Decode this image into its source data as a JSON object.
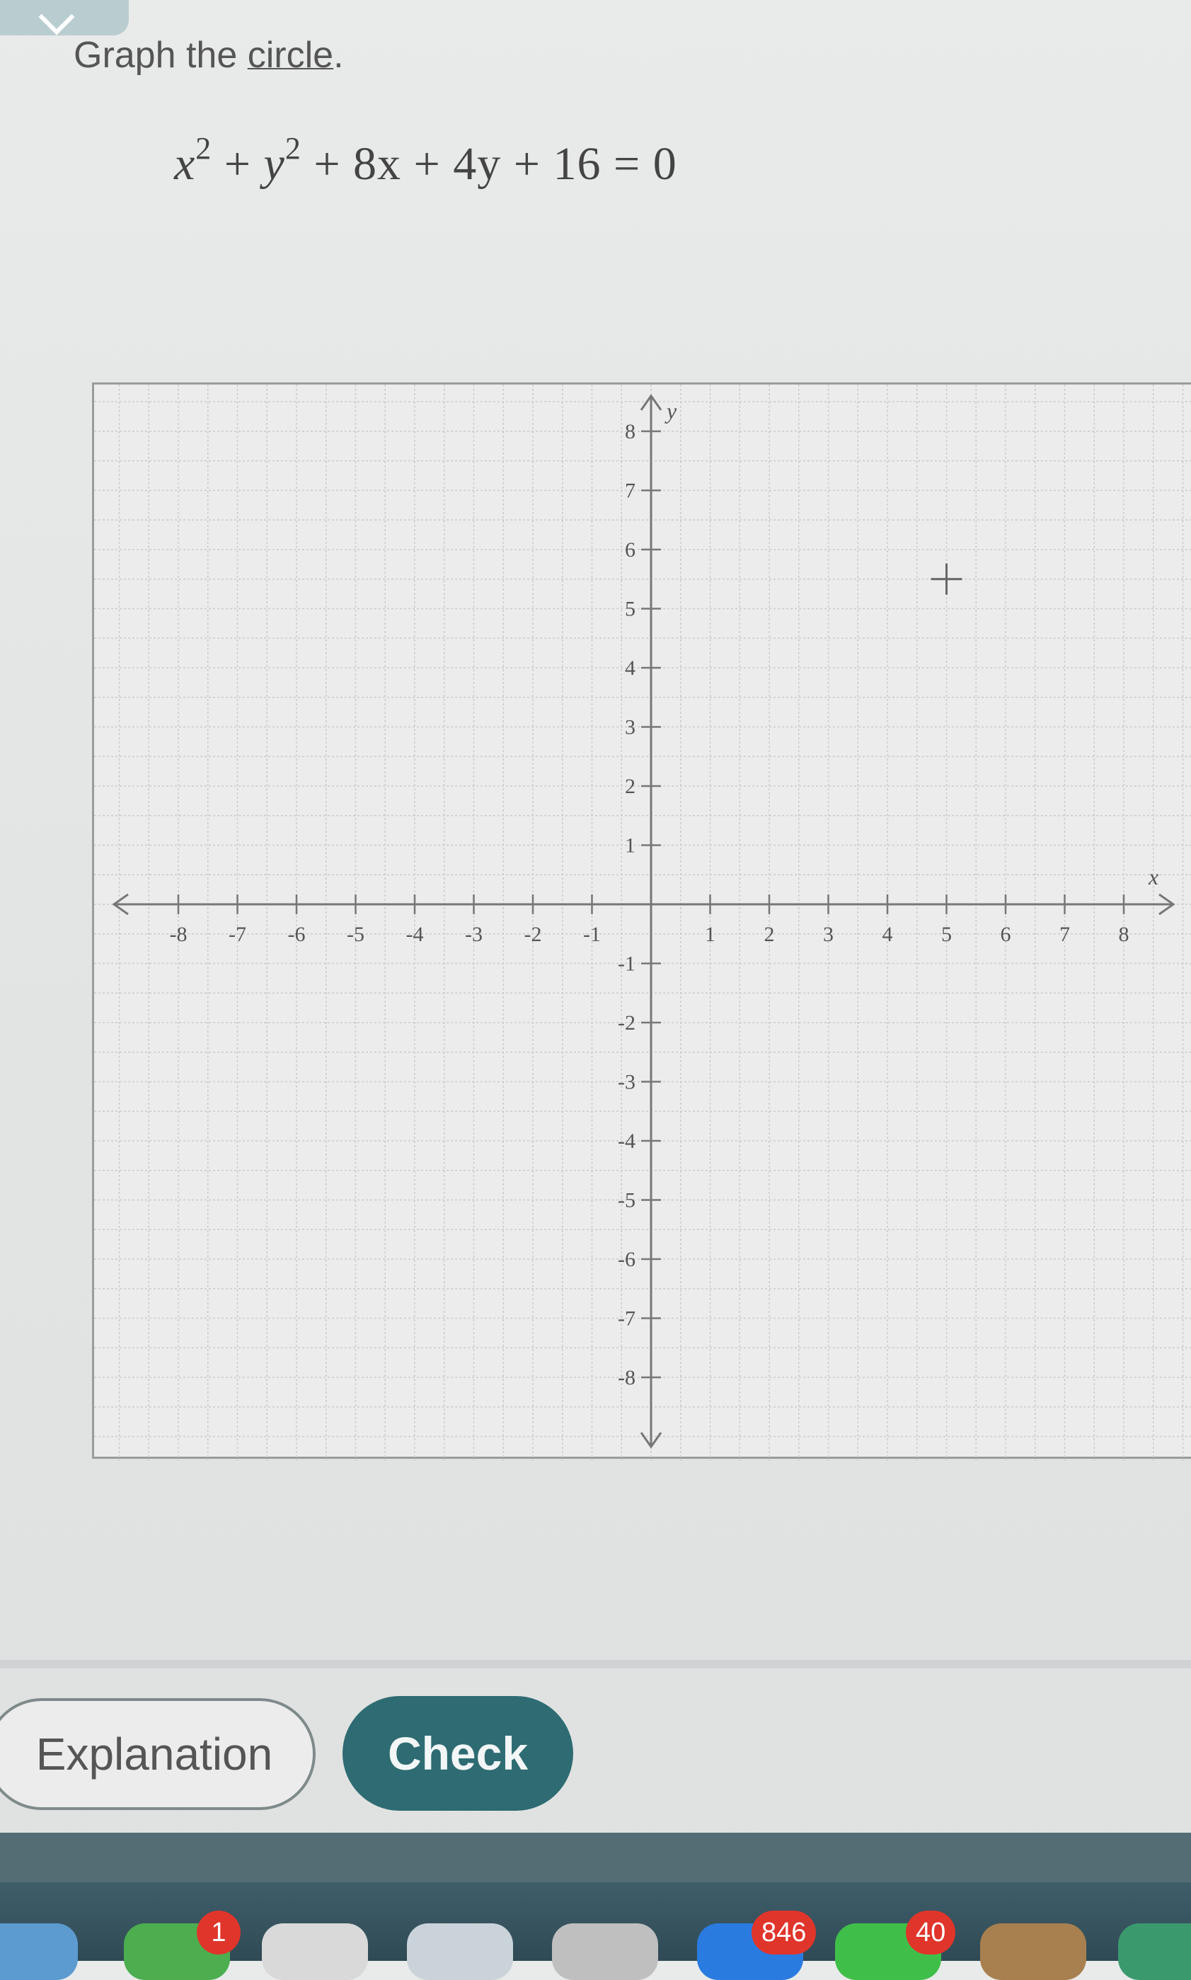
{
  "problem": {
    "prompt_text": "Graph the ",
    "prompt_link": "circle",
    "prompt_end": "."
  },
  "equation": {
    "x": "x",
    "exp1": "2",
    "plus1": " + ",
    "y": "y",
    "exp2": "2",
    "rest": " + 8x + 4y + 16 = 0"
  },
  "graph": {
    "x_axis_label": "x",
    "y_axis_label": "y",
    "x_range": [
      -8,
      8
    ],
    "y_range": [
      -8,
      8
    ],
    "x_ticks": [
      "-8",
      "-7",
      "-6",
      "-5",
      "-4",
      "-3",
      "-2",
      "-1",
      "1",
      "2",
      "3",
      "4",
      "5",
      "6",
      "7",
      "8"
    ],
    "y_ticks": [
      "8",
      "7",
      "6",
      "5",
      "4",
      "3",
      "2",
      "1",
      "-1",
      "-2",
      "-3",
      "-4",
      "-5",
      "-6",
      "-7",
      "-8"
    ],
    "cursor_point": {
      "x": 5,
      "y": 5.5
    }
  },
  "buttons": {
    "explanation": "Explanation",
    "check": "Check"
  },
  "dock": {
    "badges": [
      "1",
      "846",
      "40"
    ]
  },
  "colors": {
    "check_button": "#2e6b72",
    "background": "#e9eaea",
    "badge": "#e0352b"
  }
}
